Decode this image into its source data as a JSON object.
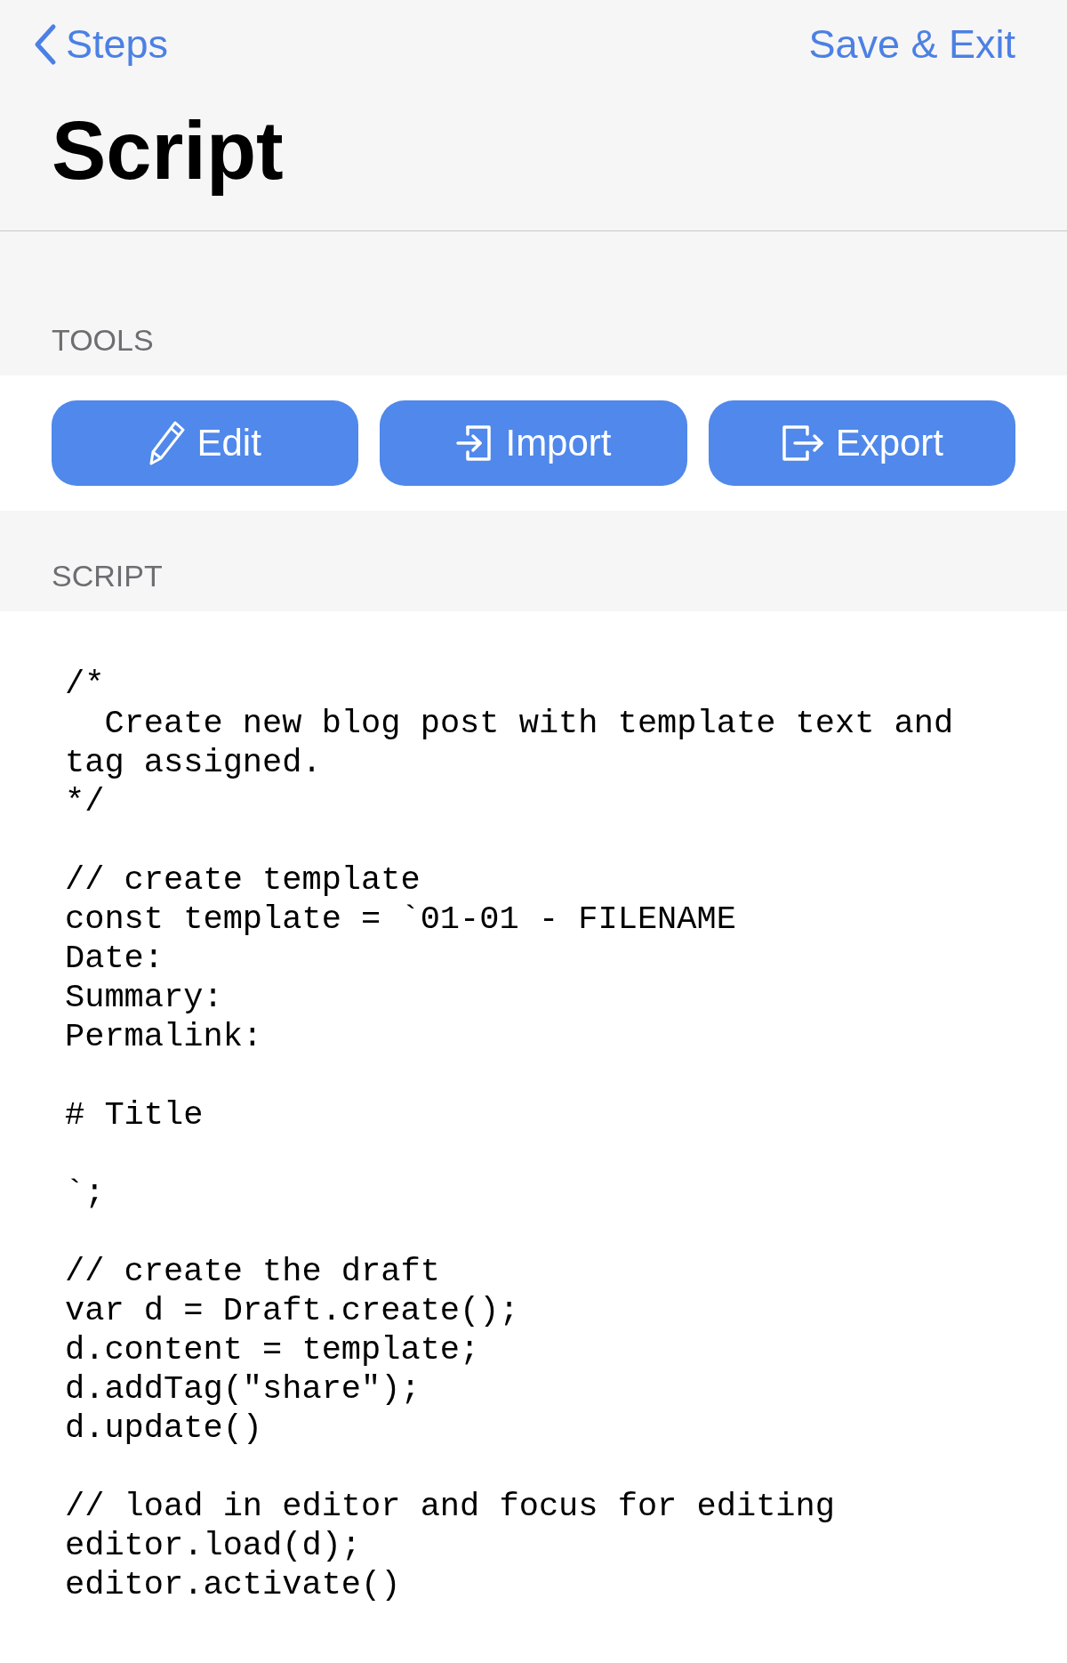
{
  "nav": {
    "back_label": "Steps",
    "action_label": "Save & Exit"
  },
  "title": "Script",
  "tools_section": {
    "header": "TOOLS",
    "buttons": [
      {
        "label": "Edit",
        "kind": "edit"
      },
      {
        "label": "Import",
        "kind": "import"
      },
      {
        "label": "Export",
        "kind": "export"
      }
    ]
  },
  "script_section": {
    "header": "SCRIPT",
    "code": "/*\n  Create new blog post with template text and\ntag assigned.\n*/\n\n// create template\nconst template = `01-01 - FILENAME\nDate:\nSummary:\nPermalink:\n\n# Title\n\n`;\n\n// create the draft\nvar d = Draft.create();\nd.content = template;\nd.addTag(\"share\");\nd.update()\n\n// load in editor and focus for editing\neditor.load(d);\neditor.activate()"
  }
}
